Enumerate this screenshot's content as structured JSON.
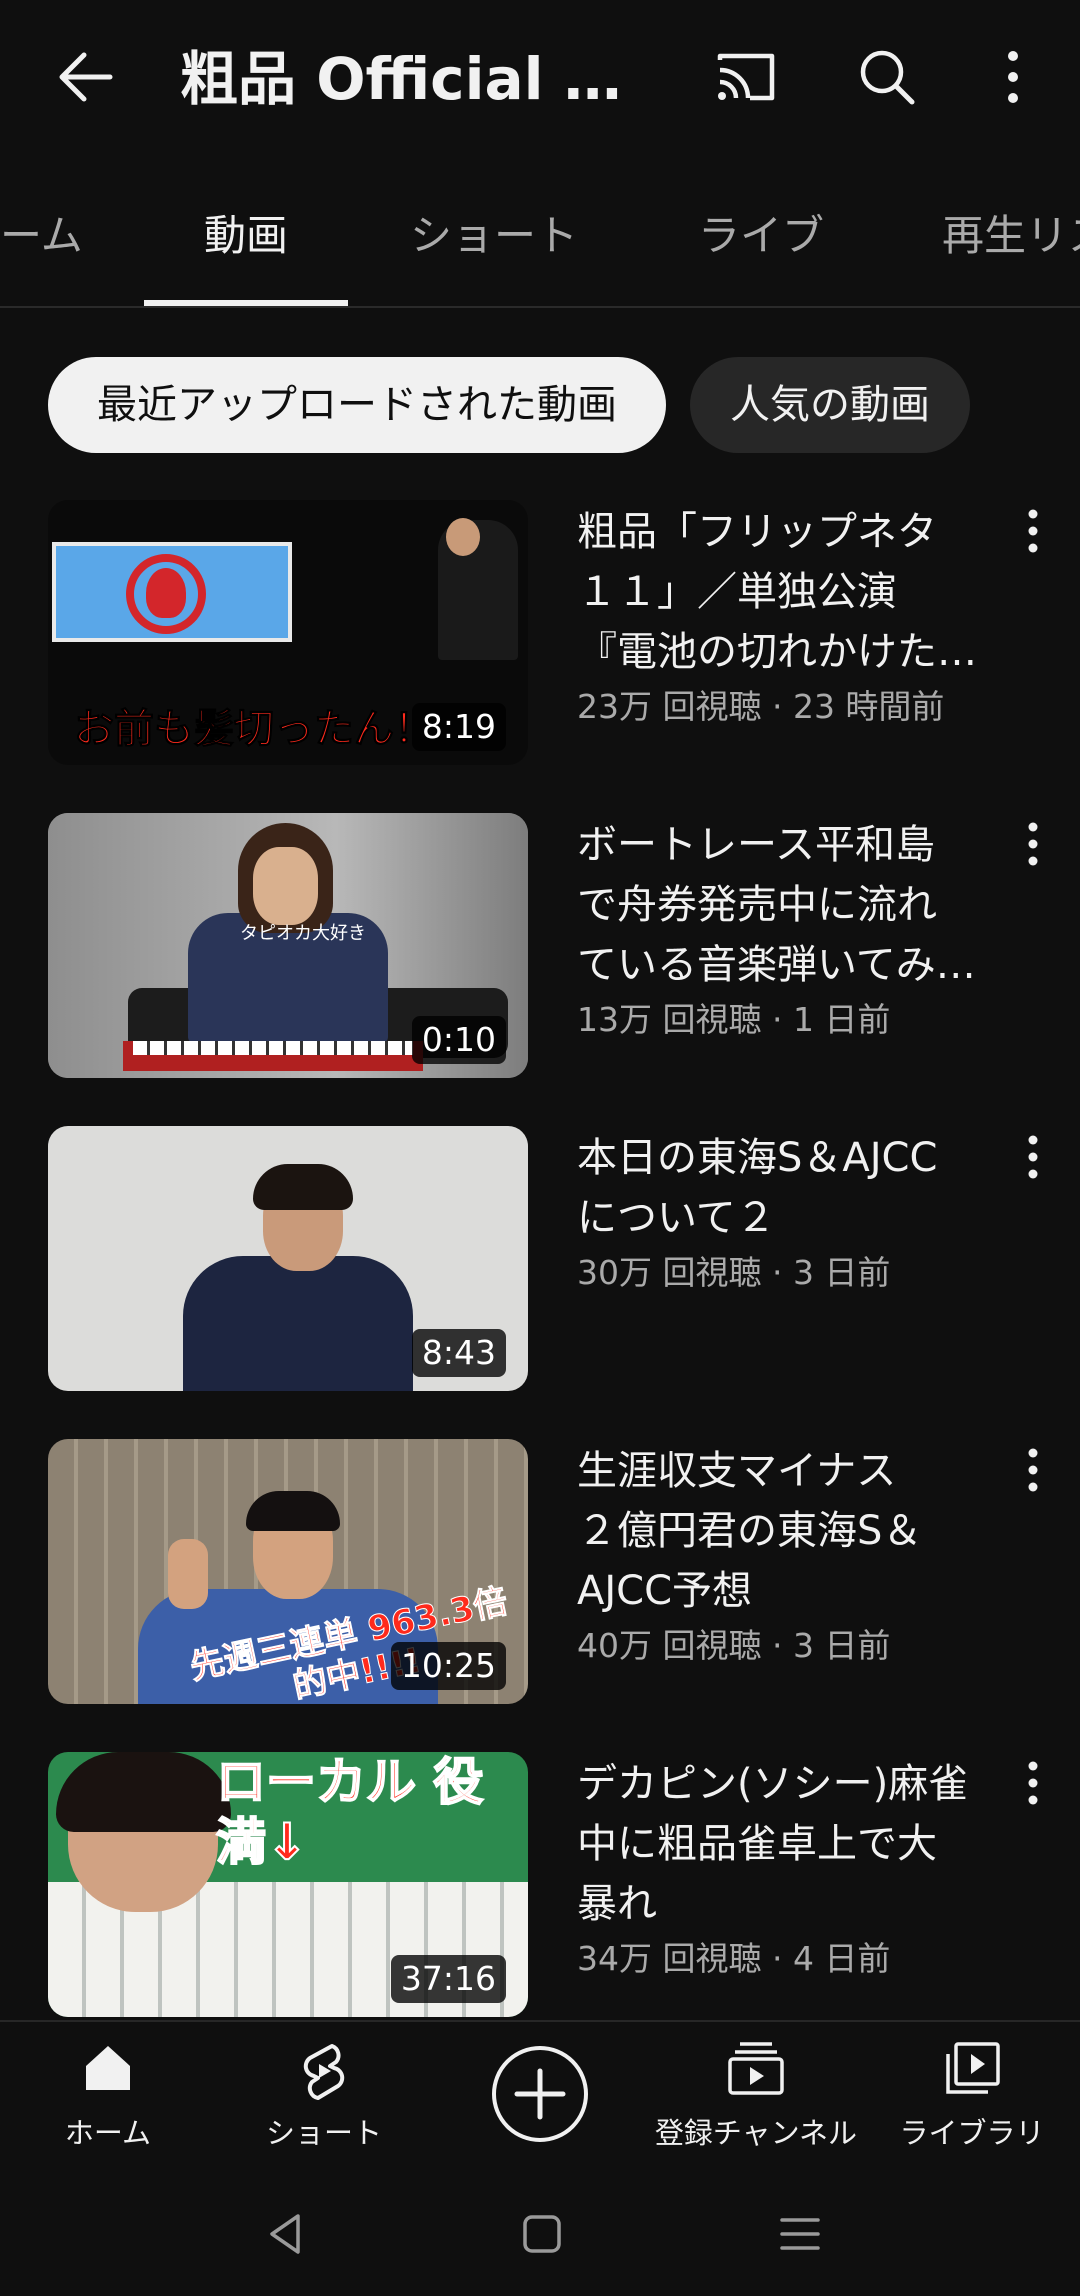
{
  "header": {
    "title": "粗品 Official Ch...",
    "back_icon": "back-arrow-icon",
    "cast_icon": "cast-icon",
    "search_icon": "search-icon",
    "more_icon": "more-vertical-icon"
  },
  "tabs": [
    {
      "label": "ーム"
    },
    {
      "label": "動画"
    },
    {
      "label": "ショート"
    },
    {
      "label": "ライブ"
    },
    {
      "label": "再生リス"
    }
  ],
  "chips": {
    "selected": "最近アップロードされた動画",
    "other": "人気の動画"
  },
  "videos": [
    {
      "title": "粗品「フリップネタ１１」／単独公演『電池の切れかけた…",
      "title_lines": [
        "粗品「フリップネタ",
        "１１」／単独公演",
        "『電池の切れかけた…"
      ],
      "meta": "23万 回視聴 · 23 時間前",
      "duration": "8:19",
      "thumb_text": "お前も髪切ったん！"
    },
    {
      "title": "ボートレース平和島で舟券発売中に流れている音楽弾いてみ…",
      "title_lines": [
        "ボートレース平和島",
        "で舟券発売中に流れ",
        "ている音楽弾いてみ…"
      ],
      "meta": "13万 回視聴 · 1 日前",
      "duration": "0:10",
      "thumb_text": "タピオカ大好き"
    },
    {
      "title": "本日の東海S＆AJCCについて２",
      "title_lines": [
        "本日の東海S＆AJCC",
        "について２"
      ],
      "meta": "30万 回視聴 · 3 日前",
      "duration": "8:43",
      "thumb_text": ""
    },
    {
      "title": "生涯収支マイナス２億円君の東海S＆AJCC予想",
      "title_lines": [
        "生涯収支マイナス",
        "２億円君の東海S＆",
        "AJCC予想"
      ],
      "meta": "40万 回視聴 · 3 日前",
      "duration": "10:25",
      "thumb_text": "先週三連単 963.3倍的中!!!!"
    },
    {
      "title": "デカピン(ソシー)麻雀中に粗品雀卓上で大暴れ",
      "title_lines": [
        "デカピン(ソシー)麻雀",
        "中に粗品雀卓上で大",
        "暴れ"
      ],
      "meta": "34万 回視聴 · 4 日前",
      "duration": "37:16",
      "thumb_text": "ローカル 役満↓"
    }
  ],
  "bottom_nav": [
    {
      "label": "ホーム",
      "icon": "home-icon"
    },
    {
      "label": "ショート",
      "icon": "shorts-icon"
    },
    {
      "label": "",
      "icon": "create-plus-icon"
    },
    {
      "label": "登録チャンネル",
      "icon": "subscriptions-icon"
    },
    {
      "label": "ライブラリ",
      "icon": "library-icon"
    }
  ],
  "system_nav": [
    "back-triangle-icon",
    "home-square-icon",
    "recents-lines-icon"
  ]
}
